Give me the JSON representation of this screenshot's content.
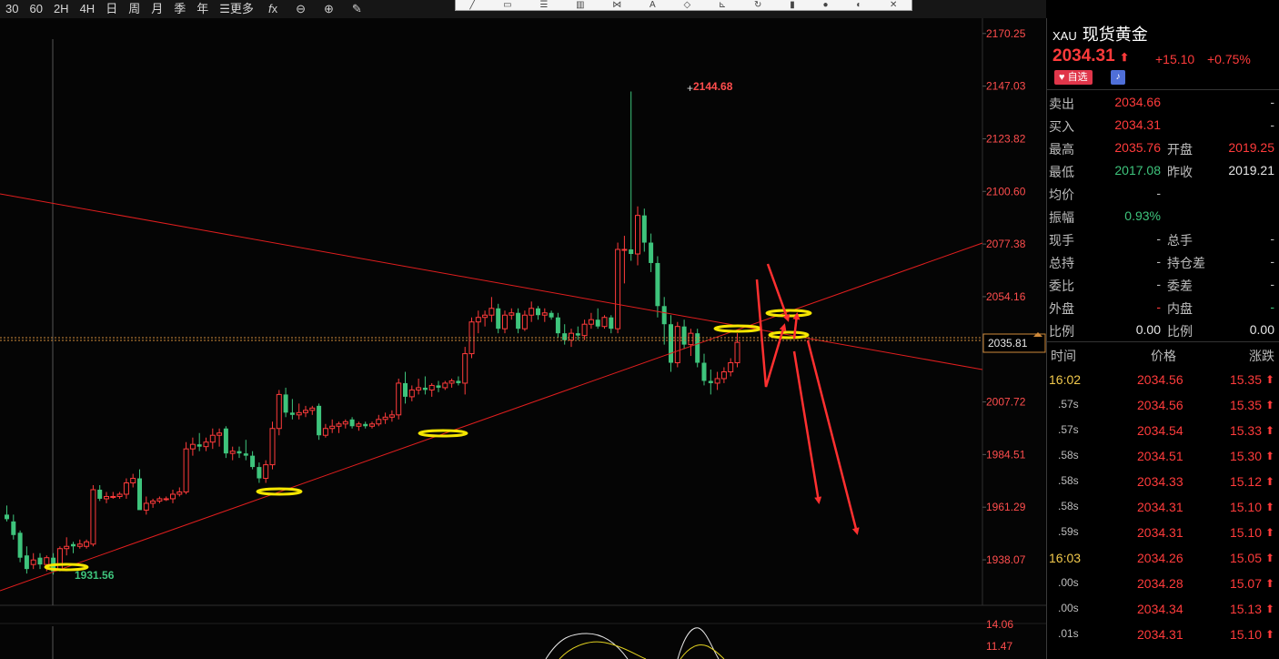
{
  "toolbar": {
    "periods": [
      "30",
      "60",
      "2H",
      "4H",
      "日",
      "周",
      "月",
      "季",
      "年"
    ],
    "more_label": "更多",
    "icons": [
      "formula-icon",
      "zoom-out-icon",
      "zoom-in-icon",
      "pen-icon"
    ]
  },
  "drawing_toolbar_icons": [
    "line-tool-icon",
    "rect-tool-icon",
    "hline-tool-icon",
    "bars-tool-icon",
    "node-tool-icon",
    "text-tool-icon",
    "tag-tool-icon",
    "measure-tool-icon",
    "refresh-tool-icon",
    "lock-tool-icon",
    "gear-tool-icon",
    "eye-tool-icon",
    "close-tool-icon"
  ],
  "chart_data": {
    "type": "candlestick",
    "yticks": [
      "2170.25",
      "2147.03",
      "2123.82",
      "2100.60",
      "2077.38",
      "2054.16",
      "2035.81",
      "2007.72",
      "1984.51",
      "1961.29",
      "1938.07"
    ],
    "ylim": [
      1918.0,
      2177.0
    ],
    "current_price_label": "2035.81",
    "high_label": "2144.68",
    "low_label": "1931.56",
    "up_color": "#ff3b3b",
    "down_color": "#3ec47c",
    "candles": [
      {
        "o": 1958,
        "h": 1962,
        "l": 1955,
        "c": 1956
      },
      {
        "o": 1955,
        "h": 1958,
        "l": 1947,
        "c": 1949
      },
      {
        "o": 1950,
        "h": 1951,
        "l": 1937,
        "c": 1939
      },
      {
        "o": 1940,
        "h": 1944,
        "l": 1932,
        "c": 1934
      },
      {
        "o": 1936,
        "h": 1941,
        "l": 1934,
        "c": 1938
      },
      {
        "o": 1939,
        "h": 1941,
        "l": 1934,
        "c": 1936
      },
      {
        "o": 1936,
        "h": 1940,
        "l": 1933,
        "c": 1939
      },
      {
        "o": 1939,
        "h": 1941,
        "l": 1931.56,
        "c": 1933
      },
      {
        "o": 1934,
        "h": 1944,
        "l": 1933,
        "c": 1943
      },
      {
        "o": 1943,
        "h": 1948,
        "l": 1940,
        "c": 1944
      },
      {
        "o": 1945,
        "h": 1946,
        "l": 1941,
        "c": 1944
      },
      {
        "o": 1944,
        "h": 1947,
        "l": 1943,
        "c": 1945
      },
      {
        "o": 1944,
        "h": 1947,
        "l": 1943,
        "c": 1946
      },
      {
        "o": 1945,
        "h": 1971,
        "l": 1944,
        "c": 1969
      },
      {
        "o": 1969,
        "h": 1971,
        "l": 1964,
        "c": 1965
      },
      {
        "o": 1965,
        "h": 1968,
        "l": 1963,
        "c": 1966
      },
      {
        "o": 1966,
        "h": 1968,
        "l": 1965,
        "c": 1966
      },
      {
        "o": 1966,
        "h": 1968,
        "l": 1965,
        "c": 1967
      },
      {
        "o": 1967,
        "h": 1974,
        "l": 1965,
        "c": 1972
      },
      {
        "o": 1972,
        "h": 1976,
        "l": 1970,
        "c": 1974
      },
      {
        "o": 1974,
        "h": 1978,
        "l": 1971,
        "c": 1960
      },
      {
        "o": 1960,
        "h": 1966,
        "l": 1958,
        "c": 1963
      },
      {
        "o": 1963,
        "h": 1965,
        "l": 1961,
        "c": 1964
      },
      {
        "o": 1964,
        "h": 1966,
        "l": 1963,
        "c": 1965
      },
      {
        "o": 1965,
        "h": 1966,
        "l": 1964,
        "c": 1965
      },
      {
        "o": 1965,
        "h": 1969,
        "l": 1963,
        "c": 1967
      },
      {
        "o": 1967,
        "h": 1970,
        "l": 1966,
        "c": 1968
      },
      {
        "o": 1968,
        "h": 1990,
        "l": 1967,
        "c": 1987
      },
      {
        "o": 1987,
        "h": 1992,
        "l": 1984,
        "c": 1989
      },
      {
        "o": 1989,
        "h": 1994,
        "l": 1986,
        "c": 1988
      },
      {
        "o": 1988,
        "h": 1992,
        "l": 1986,
        "c": 1990
      },
      {
        "o": 1990,
        "h": 1996,
        "l": 1987,
        "c": 1993
      },
      {
        "o": 1993,
        "h": 1996,
        "l": 1988,
        "c": 1994
      },
      {
        "o": 1996,
        "h": 1997,
        "l": 1983,
        "c": 1985
      },
      {
        "o": 1985,
        "h": 1988,
        "l": 1982,
        "c": 1986
      },
      {
        "o": 1986,
        "h": 1988,
        "l": 1983,
        "c": 1985
      },
      {
        "o": 1985,
        "h": 1991,
        "l": 1982,
        "c": 1984
      },
      {
        "o": 1984,
        "h": 1986,
        "l": 1978,
        "c": 1979
      },
      {
        "o": 1979,
        "h": 1981,
        "l": 1972,
        "c": 1974
      },
      {
        "o": 1974,
        "h": 1982,
        "l": 1972,
        "c": 1980
      },
      {
        "o": 1980,
        "h": 1999,
        "l": 1978,
        "c": 1996
      },
      {
        "o": 1996,
        "h": 2013,
        "l": 1993,
        "c": 2011
      },
      {
        "o": 2011,
        "h": 2014,
        "l": 2001,
        "c": 2003
      },
      {
        "o": 2003,
        "h": 2009,
        "l": 2000,
        "c": 2002
      },
      {
        "o": 2002,
        "h": 2007,
        "l": 2000,
        "c": 2003
      },
      {
        "o": 2003,
        "h": 2006,
        "l": 2001,
        "c": 2004
      },
      {
        "o": 2004,
        "h": 2006,
        "l": 2002,
        "c": 2005
      },
      {
        "o": 2006,
        "h": 2007,
        "l": 1991,
        "c": 1993
      },
      {
        "o": 1993,
        "h": 1998,
        "l": 1992,
        "c": 1996
      },
      {
        "o": 1996,
        "h": 2000,
        "l": 1994,
        "c": 1997
      },
      {
        "o": 1997,
        "h": 1999,
        "l": 1994,
        "c": 1998
      },
      {
        "o": 1998,
        "h": 2000,
        "l": 1996,
        "c": 1999
      },
      {
        "o": 2000,
        "h": 2001,
        "l": 1996,
        "c": 1997
      },
      {
        "o": 1997,
        "h": 1999,
        "l": 1995,
        "c": 1998
      },
      {
        "o": 1998,
        "h": 1999,
        "l": 1996,
        "c": 1997
      },
      {
        "o": 1997,
        "h": 1999,
        "l": 1996,
        "c": 1998
      },
      {
        "o": 1998,
        "h": 2002,
        "l": 1997,
        "c": 2000
      },
      {
        "o": 2000,
        "h": 2003,
        "l": 1998,
        "c": 2001
      },
      {
        "o": 2001,
        "h": 2004,
        "l": 1999,
        "c": 2002
      },
      {
        "o": 2002,
        "h": 2018,
        "l": 2000,
        "c": 2016
      },
      {
        "o": 2016,
        "h": 2021,
        "l": 2007,
        "c": 2010
      },
      {
        "o": 2010,
        "h": 2015,
        "l": 2008,
        "c": 2013
      },
      {
        "o": 2013,
        "h": 2018,
        "l": 2011,
        "c": 2014
      },
      {
        "o": 2014,
        "h": 2019,
        "l": 2011,
        "c": 2013
      },
      {
        "o": 2013,
        "h": 2016,
        "l": 2010,
        "c": 2015
      },
      {
        "o": 2015,
        "h": 2017,
        "l": 2012,
        "c": 2014
      },
      {
        "o": 2014,
        "h": 2017,
        "l": 2013,
        "c": 2016
      },
      {
        "o": 2016,
        "h": 2018,
        "l": 2014,
        "c": 2017
      },
      {
        "o": 2017,
        "h": 2019,
        "l": 2015,
        "c": 2016
      },
      {
        "o": 2016,
        "h": 2032,
        "l": 2011,
        "c": 2029
      },
      {
        "o": 2029,
        "h": 2045,
        "l": 2027,
        "c": 2043
      },
      {
        "o": 2043,
        "h": 2048,
        "l": 2038,
        "c": 2045
      },
      {
        "o": 2045,
        "h": 2048,
        "l": 2041,
        "c": 2046
      },
      {
        "o": 2046,
        "h": 2054,
        "l": 2043,
        "c": 2049
      },
      {
        "o": 2049,
        "h": 2051,
        "l": 2038,
        "c": 2040
      },
      {
        "o": 2040,
        "h": 2048,
        "l": 2038,
        "c": 2046
      },
      {
        "o": 2046,
        "h": 2049,
        "l": 2044,
        "c": 2047
      },
      {
        "o": 2047,
        "h": 2049,
        "l": 2038,
        "c": 2040
      },
      {
        "o": 2040,
        "h": 2048,
        "l": 2039,
        "c": 2046
      },
      {
        "o": 2046,
        "h": 2052,
        "l": 2043,
        "c": 2049
      },
      {
        "o": 2049,
        "h": 2050,
        "l": 2044,
        "c": 2046
      },
      {
        "o": 2046,
        "h": 2049,
        "l": 2043,
        "c": 2047
      },
      {
        "o": 2047,
        "h": 2048,
        "l": 2044,
        "c": 2045
      },
      {
        "o": 2045,
        "h": 2047,
        "l": 2036,
        "c": 2038
      },
      {
        "o": 2038,
        "h": 2042,
        "l": 2033,
        "c": 2035
      },
      {
        "o": 2035,
        "h": 2040,
        "l": 2032,
        "c": 2038
      },
      {
        "o": 2038,
        "h": 2041,
        "l": 2035,
        "c": 2037
      },
      {
        "o": 2037,
        "h": 2044,
        "l": 2035,
        "c": 2042
      },
      {
        "o": 2042,
        "h": 2047,
        "l": 2040,
        "c": 2044
      },
      {
        "o": 2044,
        "h": 2049,
        "l": 2040,
        "c": 2041
      },
      {
        "o": 2041,
        "h": 2046,
        "l": 2040,
        "c": 2045
      },
      {
        "o": 2045,
        "h": 2046,
        "l": 2038,
        "c": 2040
      },
      {
        "o": 2040,
        "h": 2078,
        "l": 2038,
        "c": 2075
      },
      {
        "o": 2075,
        "h": 2081,
        "l": 2060,
        "c": 2075
      },
      {
        "o": 2075,
        "h": 2144.68,
        "l": 2070,
        "c": 2073
      },
      {
        "o": 2073,
        "h": 2094,
        "l": 2068,
        "c": 2090
      },
      {
        "o": 2090,
        "h": 2093,
        "l": 2074,
        "c": 2078
      },
      {
        "o": 2078,
        "h": 2082,
        "l": 2065,
        "c": 2069
      },
      {
        "o": 2069,
        "h": 2072,
        "l": 2045,
        "c": 2050
      },
      {
        "o": 2050,
        "h": 2054,
        "l": 2033,
        "c": 2042
      },
      {
        "o": 2042,
        "h": 2046,
        "l": 2021,
        "c": 2025
      },
      {
        "o": 2025,
        "h": 2043,
        "l": 2023,
        "c": 2041
      },
      {
        "o": 2041,
        "h": 2044,
        "l": 2031,
        "c": 2033
      },
      {
        "o": 2033,
        "h": 2040,
        "l": 2028,
        "c": 2038
      },
      {
        "o": 2038,
        "h": 2040,
        "l": 2023,
        "c": 2025
      },
      {
        "o": 2025,
        "h": 2029,
        "l": 2015,
        "c": 2017
      },
      {
        "o": 2017,
        "h": 2022,
        "l": 2011,
        "c": 2016
      },
      {
        "o": 2016,
        "h": 2021,
        "l": 2013,
        "c": 2018
      },
      {
        "o": 2018,
        "h": 2023,
        "l": 2016,
        "c": 2021
      },
      {
        "o": 2021,
        "h": 2027,
        "l": 2019,
        "c": 2025
      },
      {
        "o": 2025,
        "h": 2038,
        "l": 2023,
        "c": 2034
      }
    ]
  },
  "panel": {
    "symbol": "XAU",
    "name": "现货黄金",
    "price": "2034.31",
    "change": "+15.10",
    "change_pct": "+0.75%",
    "fav_label": "自选",
    "quotes": [
      {
        "l1": "卖出",
        "v1": "2034.66",
        "c1": "red",
        "l2": "",
        "v2": "-",
        "c2": "gray"
      },
      {
        "l1": "买入",
        "v1": "2034.31",
        "c1": "red",
        "l2": "",
        "v2": "-",
        "c2": "gray"
      },
      {
        "l1": "最高",
        "v1": "2035.76",
        "c1": "red",
        "l2": "开盘",
        "v2": "2019.25",
        "c2": "red"
      },
      {
        "l1": "最低",
        "v1": "2017.08",
        "c1": "green",
        "l2": "昨收",
        "v2": "2019.21",
        "c2": "white"
      },
      {
        "l1": "均价",
        "v1": "-",
        "c1": "gray",
        "l2": "",
        "v2": "",
        "c2": "gray"
      },
      {
        "l1": "振幅",
        "v1": "0.93%",
        "c1": "green",
        "l2": "",
        "v2": "",
        "c2": "gray"
      },
      {
        "l1": "现手",
        "v1": "-",
        "c1": "gray",
        "l2": "总手",
        "v2": "-",
        "c2": "gray"
      },
      {
        "l1": "总持",
        "v1": "-",
        "c1": "gray",
        "l2": "持仓差",
        "v2": "-",
        "c2": "gray"
      },
      {
        "l1": "委比",
        "v1": "-",
        "c1": "gray",
        "l2": "委差",
        "v2": "-",
        "c2": "gray"
      },
      {
        "l1": "外盘",
        "v1": "-",
        "c1": "red",
        "l2": "内盘",
        "v2": "-",
        "c2": "green"
      },
      {
        "l1": "比例",
        "v1": "0.00",
        "c1": "white",
        "l2": "比例",
        "v2": "0.00",
        "c2": "white"
      }
    ],
    "tick_headers": [
      "时间",
      "价格",
      "涨跌"
    ],
    "ticks": [
      {
        "t": "16:02",
        "p": "2034.56",
        "c": "15.35",
        "hl": true
      },
      {
        "t": ".57s",
        "p": "2034.56",
        "c": "15.35",
        "hl": false
      },
      {
        "t": ".57s",
        "p": "2034.54",
        "c": "15.33",
        "hl": false
      },
      {
        "t": ".58s",
        "p": "2034.51",
        "c": "15.30",
        "hl": false
      },
      {
        "t": ".58s",
        "p": "2034.33",
        "c": "15.12",
        "hl": false
      },
      {
        "t": ".58s",
        "p": "2034.31",
        "c": "15.10",
        "hl": false
      },
      {
        "t": ".59s",
        "p": "2034.31",
        "c": "15.10",
        "hl": false
      },
      {
        "t": "16:03",
        "p": "2034.26",
        "c": "15.05",
        "hl": true
      },
      {
        "t": ".00s",
        "p": "2034.28",
        "c": "15.07",
        "hl": false
      },
      {
        "t": ".00s",
        "p": "2034.34",
        "c": "15.13",
        "hl": false
      },
      {
        "t": ".01s",
        "p": "2034.31",
        "c": "15.10",
        "hl": false
      }
    ]
  },
  "indicator": {
    "labels": [
      "14.06",
      "11.47"
    ]
  }
}
